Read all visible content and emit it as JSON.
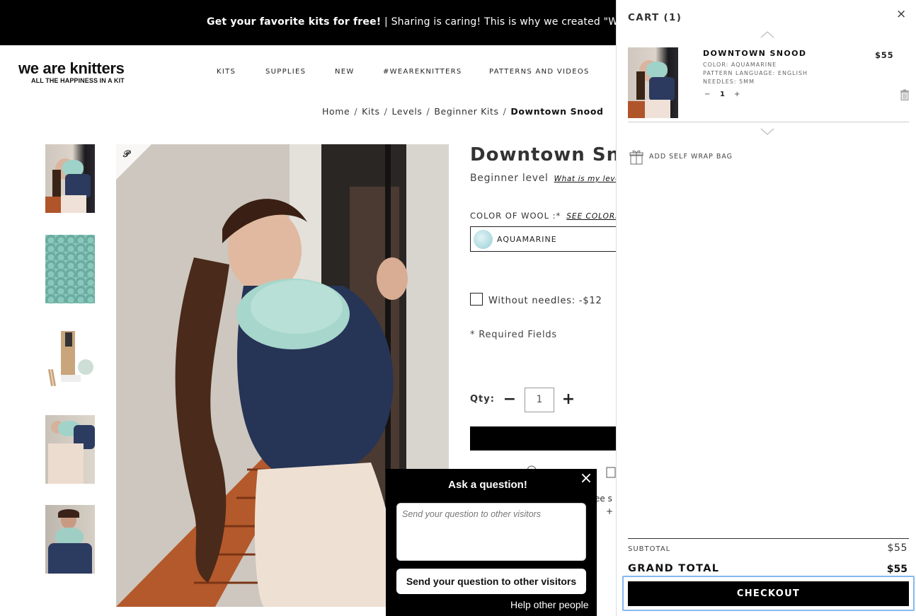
{
  "banner": {
    "bold": "Get your favorite kits for free!",
    "rest": " | Sharing is caring! This is why we created \"WAK F"
  },
  "logo": {
    "line1": "we are knitters",
    "line2": "ALL THE HAPPINESS IN A KIT"
  },
  "nav": [
    "KITS",
    "SUPPLIES",
    "NEW",
    "#WEAREKNITTERS",
    "PATTERNS AND VIDEOS"
  ],
  "breadcrumb": [
    "Home",
    "Kits",
    "Levels",
    "Beginner Kits"
  ],
  "breadcrumb_current": "Downtown Snood",
  "breadcrumb_sep": "/",
  "product": {
    "title": "Downtown Sno",
    "level": "Beginner level",
    "level_link": "What is my leve",
    "color_label": "COLOR OF WOOL :*",
    "color_link": "SEE COLORS",
    "color_selected": "AQUAMARINE",
    "without_needles": "Without needles: -$12",
    "required": "* Required Fields",
    "qty_label": "Qty:",
    "qty_value": "1",
    "minus": "−",
    "plus": "+",
    "frag1": "ee s",
    "frag2": "+"
  },
  "ask": {
    "title": "Ask a question!",
    "close": "×",
    "placeholder": "Send your question to other visitors",
    "button": "Send your question to other visitors",
    "help": "Help other people"
  },
  "cart": {
    "header": "CART (1)",
    "close": "×",
    "item": {
      "name": "DOWNTOWN SNOOD",
      "price": "$55",
      "options": [
        "COLOR: AQUAMARINE",
        "PATTERN LANGUAGE: ENGLISH",
        "NEEDLES: 5MM"
      ],
      "qty": "1",
      "minus": "−",
      "plus": "+"
    },
    "gift_label": "ADD SELF WRAP BAG",
    "subtotal_label": "SUBTOTAL",
    "subtotal_value": "$55",
    "grand_total_label": "GRAND TOTAL",
    "grand_total_value": "$55",
    "checkout": "CHECKOUT"
  },
  "colors": {
    "banner_bg": "#000000",
    "accent_mint": "#7fbfb3",
    "focus_ring": "#86b9ee"
  }
}
